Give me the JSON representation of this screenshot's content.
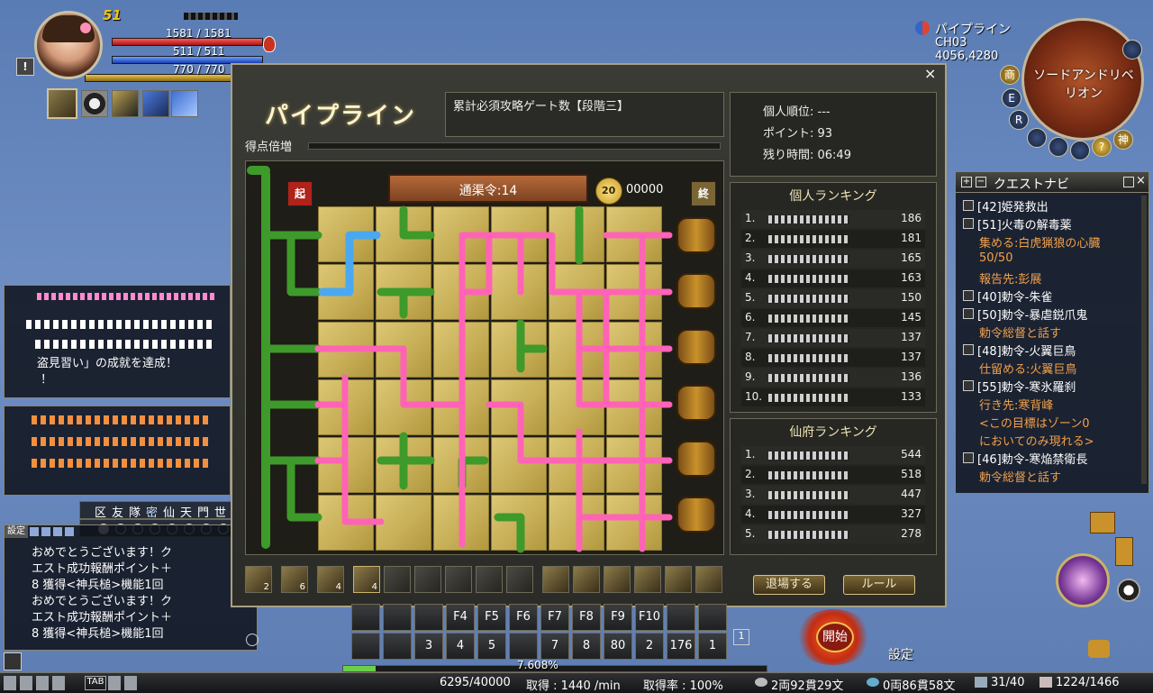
{
  "player": {
    "level": "51",
    "hp_text": "1581 / 1581",
    "mp_text": "511 / 511",
    "sp_text": "770 / 770",
    "hp_fraction": 1.0,
    "mp_fraction": 1.0,
    "sp_fraction": 1.0
  },
  "location": {
    "name": "パイプライン",
    "channel": "CH03",
    "coords": "4056,4280"
  },
  "minimap": {
    "logo_text": "ソードアンドリベリオン",
    "buttons": [
      "商",
      "E",
      "R",
      "神"
    ]
  },
  "pipeline": {
    "title": "パイプライン",
    "subtitle_label": "得点倍増",
    "gate_text": "累計必須攻略ゲート数【段階三】",
    "start_label": "起",
    "end_label": "終",
    "plate_text": "通渠令:14",
    "coin_badge": "20",
    "coin_score": "00000",
    "stats": {
      "rank": "個人順位: ---",
      "points": "ポイント: 93",
      "time_left": "残り時間: 06:49"
    },
    "personal_ranking": {
      "title": "個人ランキング",
      "rows": [
        {
          "idx": "1.",
          "score": "186"
        },
        {
          "idx": "2.",
          "score": "181"
        },
        {
          "idx": "3.",
          "score": "165"
        },
        {
          "idx": "4.",
          "score": "163"
        },
        {
          "idx": "5.",
          "score": "150"
        },
        {
          "idx": "6.",
          "score": "145"
        },
        {
          "idx": "7.",
          "score": "137"
        },
        {
          "idx": "8.",
          "score": "137"
        },
        {
          "idx": "9.",
          "score": "136"
        },
        {
          "idx": "10.",
          "score": "133"
        }
      ]
    },
    "house_ranking": {
      "title": "仙府ランキング",
      "rows": [
        {
          "idx": "1.",
          "score": "544"
        },
        {
          "idx": "2.",
          "score": "518"
        },
        {
          "idx": "3.",
          "score": "447"
        },
        {
          "idx": "4.",
          "score": "327"
        },
        {
          "idx": "5.",
          "score": "278"
        }
      ]
    },
    "skill_counts": [
      "2",
      "6",
      "4",
      "4"
    ],
    "leave_button": "退場する",
    "rule_button": "ルール"
  },
  "quest_navi": {
    "title": "クエストナビ",
    "lines": [
      {
        "text": "[42]姫発救出",
        "color": "#ffffff"
      },
      {
        "text": "[51]火毒の解毒薬",
        "color": "#ffffff"
      },
      {
        "text": "集める:白虎猟狼の心臓",
        "color": "#f2a04a"
      },
      {
        "text": "50/50",
        "color": "#f2a04a"
      },
      {
        "text": "報告先:彭展",
        "color": "#f2a04a"
      },
      {
        "text": "[40]勅令-朱雀",
        "color": "#ffffff"
      },
      {
        "text": "[50]勅令-暴虐鋭爪鬼",
        "color": "#ffffff"
      },
      {
        "text": "勅令総督と話す",
        "color": "#f2a04a"
      },
      {
        "text": "[48]勅令-火翼巨鳥",
        "color": "#ffffff"
      },
      {
        "text": "仕留める:火翼巨鳥",
        "color": "#f2a04a"
      },
      {
        "text": "[55]勅令-寒氷羅刹",
        "color": "#ffffff"
      },
      {
        "text": "行き先:寒背峰",
        "color": "#f2a04a"
      },
      {
        "text": "<この目標はゾーン0",
        "color": "#f2a04a"
      },
      {
        "text": "においてのみ現れる>",
        "color": "#f2a04a"
      },
      {
        "text": "[46]勅令-寒焔禁衛長",
        "color": "#ffffff"
      },
      {
        "text": "勅令総督と話す",
        "color": "#f2a04a"
      }
    ]
  },
  "chat_upper": {
    "line1": "盗見習い」の成就を達成！",
    "line2": "！"
  },
  "chat_tabs": [
    "区",
    "友",
    "隊",
    "密",
    "仙",
    "天",
    "門",
    "世"
  ],
  "chat_settings_label": "設定",
  "chat_log": [
    "おめでとうございます！ク",
    "エスト成功報酬ポイント＋",
    "8 獲得<神兵槌>機能1回",
    "おめでとうございます！ク",
    "エスト成功報酬ポイント＋",
    "8 獲得<神兵槌>機能1回"
  ],
  "hotbar": {
    "row1": [
      "",
      "",
      "",
      "F4",
      "F5",
      "F6",
      "F7",
      "F8",
      "F9",
      "F10",
      "",
      ""
    ],
    "row2": [
      "",
      "",
      "3",
      "4",
      "5",
      "",
      "7",
      "8",
      "80",
      "2",
      "176",
      "1"
    ]
  },
  "start_button": "開始",
  "settings_label": "設定",
  "exp_percent": "7.608%",
  "status_bar": {
    "exp": "6295/40000",
    "gain": "取得 : 1440 /min",
    "rate": "取得率 : 100%",
    "money1": "2両92貫29文",
    "money2": "0両86貫58文",
    "bag": "31/40",
    "weight": "1224/1466"
  },
  "bottom_tab": "TAB"
}
